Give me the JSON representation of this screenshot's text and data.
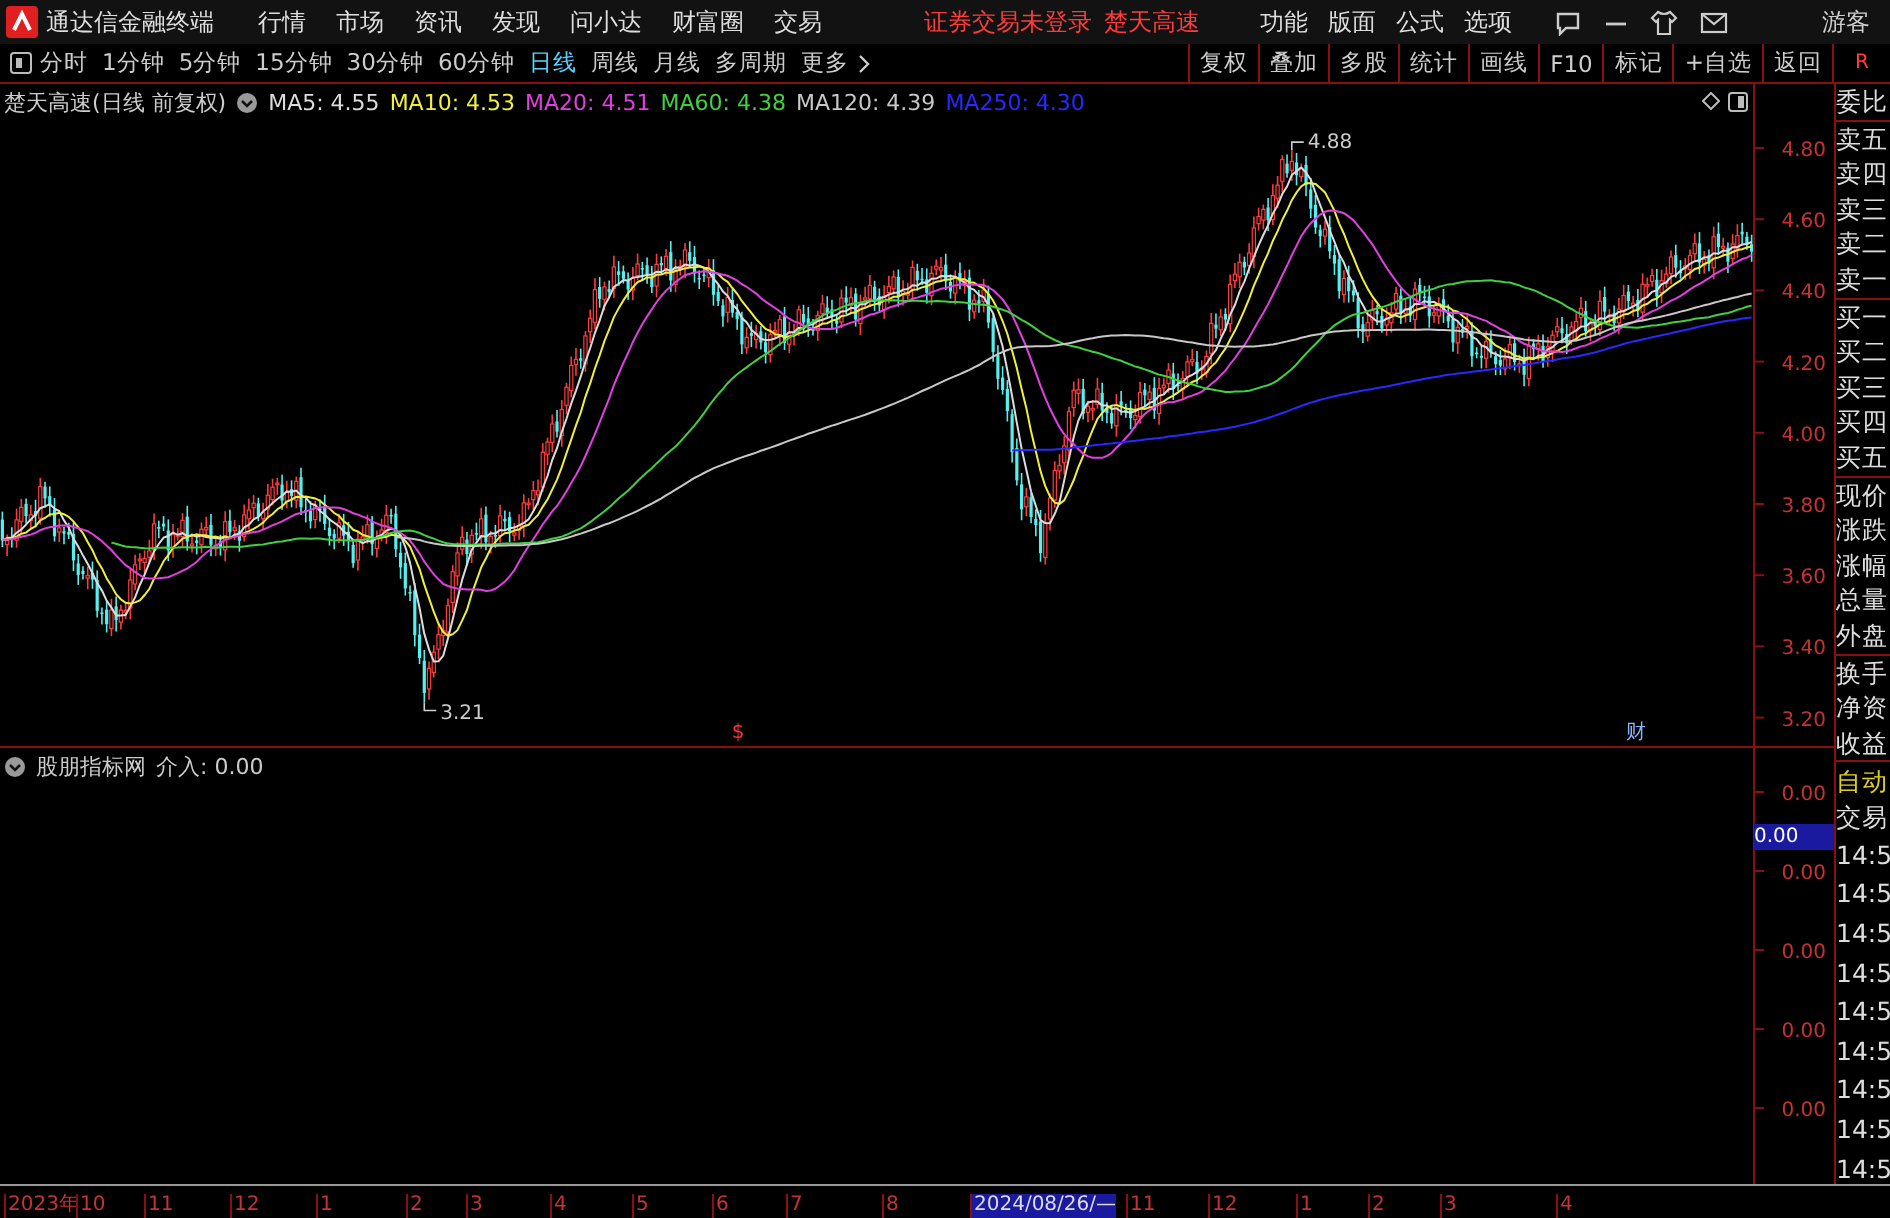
{
  "app_title": "通达信金融终端",
  "menu": [
    "行情",
    "市场",
    "资讯",
    "发现",
    "问小达",
    "财富圈",
    "交易"
  ],
  "notices": [
    "证券交易未登录",
    "楚天高速"
  ],
  "right_menu": [
    "功能",
    "版面",
    "公式",
    "选项"
  ],
  "user": "游客",
  "periods": [
    {
      "label": "分时",
      "selected": false
    },
    {
      "label": "1分钟",
      "selected": false
    },
    {
      "label": "5分钟",
      "selected": false
    },
    {
      "label": "15分钟",
      "selected": false
    },
    {
      "label": "30分钟",
      "selected": false
    },
    {
      "label": "60分钟",
      "selected": false
    },
    {
      "label": "日线",
      "selected": true
    },
    {
      "label": "周线",
      "selected": false
    },
    {
      "label": "月线",
      "selected": false
    },
    {
      "label": "多周期",
      "selected": false
    },
    {
      "label": "更多",
      "selected": false
    }
  ],
  "tools": [
    "复权",
    "叠加",
    "多股",
    "统计",
    "画线",
    "F10",
    "标记",
    "+自选",
    "返回"
  ],
  "r_label": "R",
  "main": {
    "title": "楚天高速(日线 前复权)",
    "ma": [
      {
        "text": "MA5: 4.55",
        "color": "#dcdcdc"
      },
      {
        "text": "MA10: 4.53",
        "color": "#f0f03c"
      },
      {
        "text": "MA20: 4.51",
        "color": "#e040e0"
      },
      {
        "text": "MA60: 4.38",
        "color": "#40d040"
      },
      {
        "text": "MA120: 4.39",
        "color": "#c8c8c8"
      },
      {
        "text": "MA250: 4.30",
        "color": "#2828ff"
      }
    ],
    "price_ticks": [
      "4.80",
      "4.60",
      "4.40",
      "4.20",
      "4.00",
      "3.80",
      "3.60",
      "3.40",
      "3.20"
    ],
    "high_label": "4.88",
    "low_label": "3.21",
    "markers": [
      {
        "text": "$",
        "kind": "dividend"
      },
      {
        "text": "财",
        "kind": "report"
      }
    ]
  },
  "indicator": {
    "title": "股朋指标网",
    "reading": "介入: 0.00",
    "ticks": [
      "0.00",
      "0.00",
      "0.00",
      "0.00",
      "0.00"
    ],
    "cursor_value": "0.00"
  },
  "side_panel": {
    "groups": [
      [
        "委比"
      ],
      [
        "卖五",
        "卖四",
        "卖三",
        "卖二",
        "卖一"
      ],
      [
        "买一",
        "买二",
        "买三",
        "买四",
        "买五"
      ],
      [
        "现价",
        "涨跌",
        "涨幅",
        "总量",
        "外盘"
      ],
      [
        "换手",
        "净资",
        "收益"
      ]
    ],
    "trade_mode": "自动",
    "trade_label": "交易",
    "times": [
      "14:5",
      "14:5",
      "14:5",
      "14:5",
      "14:5",
      "14:5",
      "14:5",
      "14:5",
      "14:5"
    ]
  },
  "x_axis": [
    {
      "label": "2023年",
      "highlighted": false
    },
    {
      "label": "10",
      "highlighted": false
    },
    {
      "label": "11",
      "highlighted": false
    },
    {
      "label": "12",
      "highlighted": false
    },
    {
      "label": "1",
      "highlighted": false
    },
    {
      "label": "2",
      "highlighted": false
    },
    {
      "label": "3",
      "highlighted": false
    },
    {
      "label": "4",
      "highlighted": false
    },
    {
      "label": "5",
      "highlighted": false
    },
    {
      "label": "6",
      "highlighted": false
    },
    {
      "label": "7",
      "highlighted": false
    },
    {
      "label": "8",
      "highlighted": false
    },
    {
      "label": "2024/08/26/—",
      "highlighted": true
    },
    {
      "label": "11",
      "highlighted": false
    },
    {
      "label": "12",
      "highlighted": false
    },
    {
      "label": "1",
      "highlighted": false
    },
    {
      "label": "2",
      "highlighted": false
    },
    {
      "label": "3",
      "highlighted": false
    },
    {
      "label": "4",
      "highlighted": false
    }
  ]
}
